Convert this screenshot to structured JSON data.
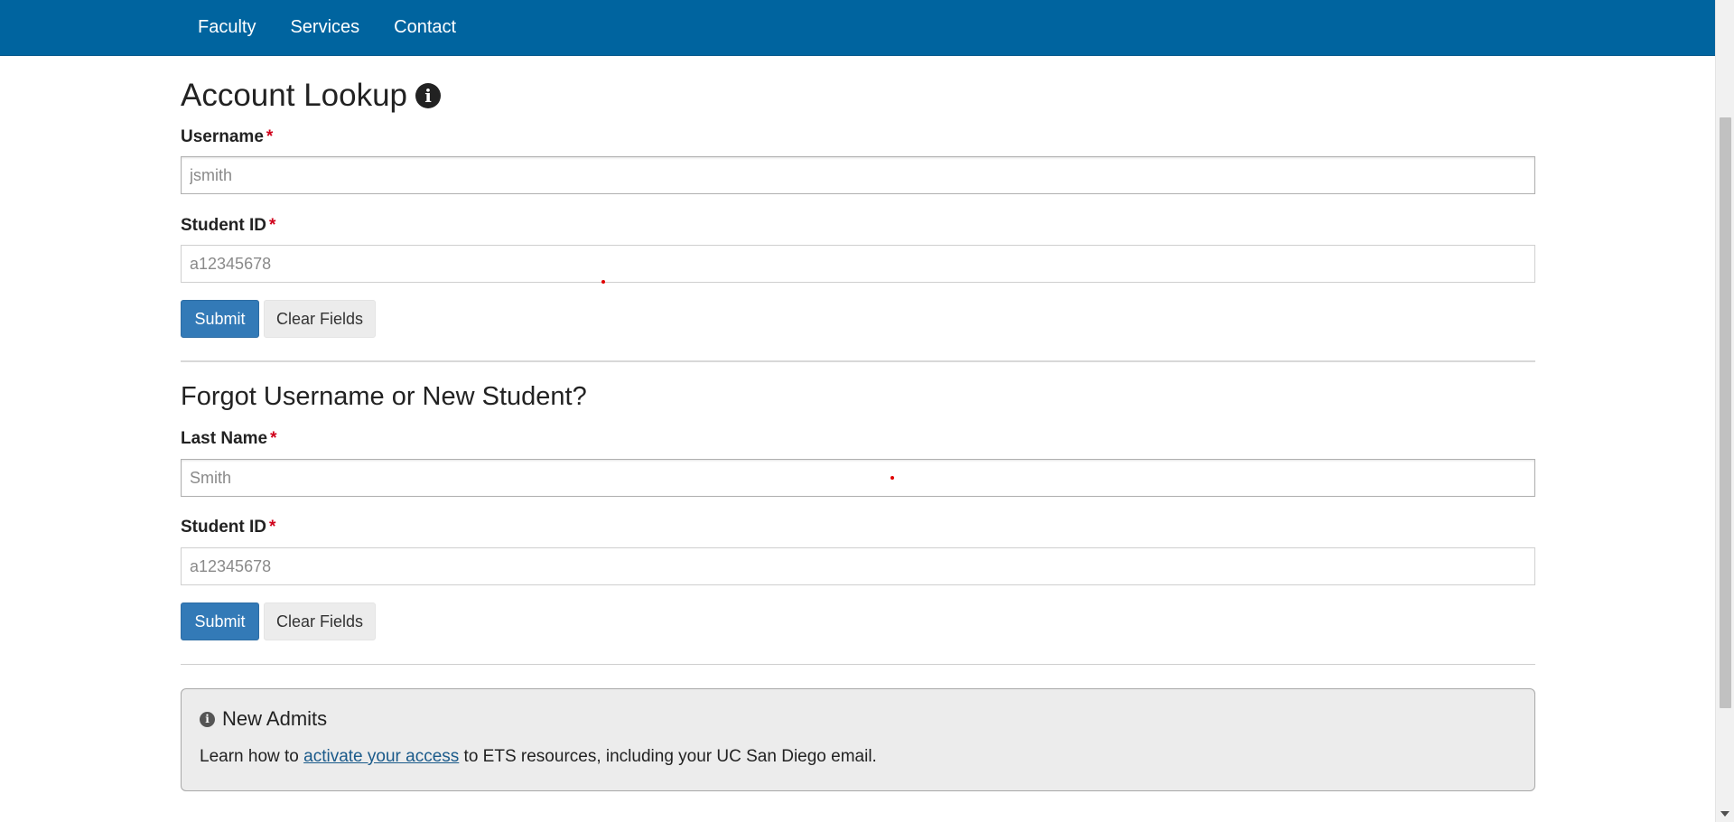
{
  "nav": {
    "items": [
      "Faculty",
      "Services",
      "Contact"
    ]
  },
  "account_lookup": {
    "title": "Account Lookup",
    "username_label": "Username",
    "username_placeholder": "jsmith",
    "student_id_label": "Student ID",
    "student_id_placeholder": "a12345678",
    "required_marker": "*",
    "submit_label": "Submit",
    "clear_label": "Clear Fields"
  },
  "forgot": {
    "title": "Forgot Username or New Student?",
    "last_name_label": "Last Name",
    "last_name_placeholder": "Smith",
    "student_id_label": "Student ID",
    "student_id_placeholder": "a12345678",
    "required_marker": "*",
    "submit_label": "Submit",
    "clear_label": "Clear Fields"
  },
  "new_admits": {
    "title": "New Admits",
    "text_before": "Learn how to ",
    "link_text": "activate your access",
    "text_after": " to ETS resources, including your UC San Diego email."
  },
  "icons": {
    "info_glyph": "i"
  },
  "colors": {
    "navbar": "#00649f",
    "primary_button": "#337ab7",
    "required": "#d0021b",
    "link": "#1a5a8a"
  }
}
